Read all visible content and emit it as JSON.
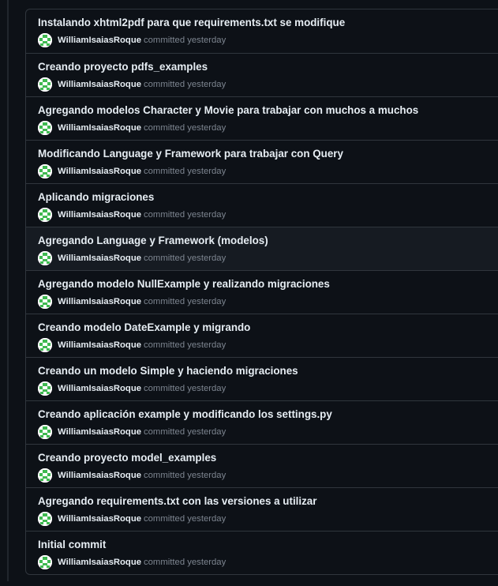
{
  "commits": [
    {
      "title": "Instalando xhtml2pdf para que requirements.txt se modifique",
      "author": "WilliamIsaiasRoque",
      "committed": "committed yesterday"
    },
    {
      "title": "Creando proyecto pdfs_examples",
      "author": "WilliamIsaiasRoque",
      "committed": "committed yesterday"
    },
    {
      "title": "Agregando modelos Character y Movie para trabajar con muchos a muchos",
      "author": "WilliamIsaiasRoque",
      "committed": "committed yesterday"
    },
    {
      "title": "Modificando Language y Framework para trabajar con Query",
      "author": "WilliamIsaiasRoque",
      "committed": "committed yesterday"
    },
    {
      "title": "Aplicando migraciones",
      "author": "WilliamIsaiasRoque",
      "committed": "committed yesterday"
    },
    {
      "title": "Agregando Language y Framework (modelos)",
      "author": "WilliamIsaiasRoque",
      "committed": "committed yesterday"
    },
    {
      "title": "Agregando modelo NullExample y realizando migraciones",
      "author": "WilliamIsaiasRoque",
      "committed": "committed yesterday"
    },
    {
      "title": "Creando modelo DateExample y migrando",
      "author": "WilliamIsaiasRoque",
      "committed": "committed yesterday"
    },
    {
      "title": "Creando un modelo Simple y haciendo migraciones",
      "author": "WilliamIsaiasRoque",
      "committed": "committed yesterday"
    },
    {
      "title": "Creando aplicación example y modificando los settings.py",
      "author": "WilliamIsaiasRoque",
      "committed": "committed yesterday"
    },
    {
      "title": "Creando proyecto model_examples",
      "author": "WilliamIsaiasRoque",
      "committed": "committed yesterday"
    },
    {
      "title": "Agregando requirements.txt con las versiones a utilizar",
      "author": "WilliamIsaiasRoque",
      "committed": "committed yesterday"
    },
    {
      "title": "Initial commit",
      "author": "WilliamIsaiasRoque",
      "committed": "committed yesterday"
    }
  ],
  "highlighted_index": 5,
  "avatar_icon": "identicon-avatar",
  "colors": {
    "background": "#0d1117",
    "border": "#30363d",
    "title_text": "#e6edf3",
    "muted_text": "#7d8590",
    "avatar_green": "#3fb950",
    "hover_row": "#161b22"
  }
}
